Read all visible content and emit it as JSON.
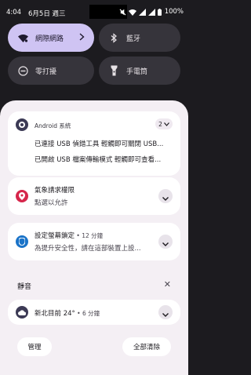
{
  "status_bar": {
    "time": "4:04",
    "date": "6月5日 週三",
    "battery": "100%"
  },
  "quick_settings": {
    "tiles": [
      {
        "label": "網際網路",
        "icon": "wifi-icon",
        "active": true
      },
      {
        "label": "藍牙",
        "icon": "bluetooth-icon",
        "active": false
      },
      {
        "label": "零打擾",
        "icon": "do-not-disturb-icon",
        "active": false
      },
      {
        "label": "手電筒",
        "icon": "flashlight-icon",
        "active": false
      }
    ]
  },
  "notifications": {
    "android": {
      "app_name": "Android 系統",
      "count": "2",
      "lines": [
        "已連接 USB 偵錯工具  輕觸即可關閉 USB...",
        "已開啟 USB 檔案傳輸模式  輕觸即可查看..."
      ]
    },
    "weather_permission": {
      "title": "氣象請求權限",
      "text": "點選以允許"
    },
    "screen_lock": {
      "title": "設定螢幕鎖定",
      "time": "12 分鐘",
      "text": "為提升安全性，請在這部裝置上設..."
    }
  },
  "silent_section": {
    "title": "靜音",
    "weather": {
      "title": "新北目前 24°",
      "time": "6 分鐘"
    }
  },
  "footer": {
    "manage": "管理",
    "clear_all": "全部清除"
  },
  "colors": {
    "scrim": "#1c1b1f",
    "panel": "#f4eff4",
    "active_tile": "#cfc4f3",
    "inactive_tile": "#36343b"
  }
}
